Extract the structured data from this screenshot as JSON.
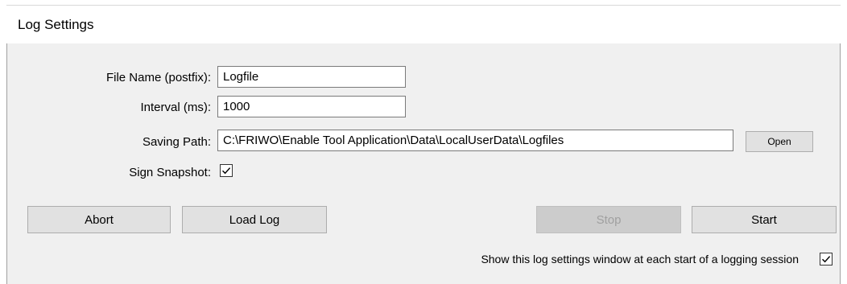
{
  "window": {
    "title": "Log Settings"
  },
  "form": {
    "file_name": {
      "label": "File Name (postfix):",
      "value": "Logfile"
    },
    "interval": {
      "label": "Interval (ms):",
      "value": "1000"
    },
    "saving_path": {
      "label": "Saving Path:",
      "value": "C:\\FRIWO\\Enable Tool Application\\Data\\LocalUserData\\Logfiles",
      "open_label": "Open"
    },
    "sign_snapshot": {
      "label": "Sign Snapshot:",
      "checked": true
    }
  },
  "buttons": {
    "abort": "Abort",
    "load_log": "Load Log",
    "stop": "Stop",
    "start": "Start"
  },
  "footer": {
    "show_window_label": "Show this log settings window at each start of a logging session",
    "show_window_checked": true
  }
}
